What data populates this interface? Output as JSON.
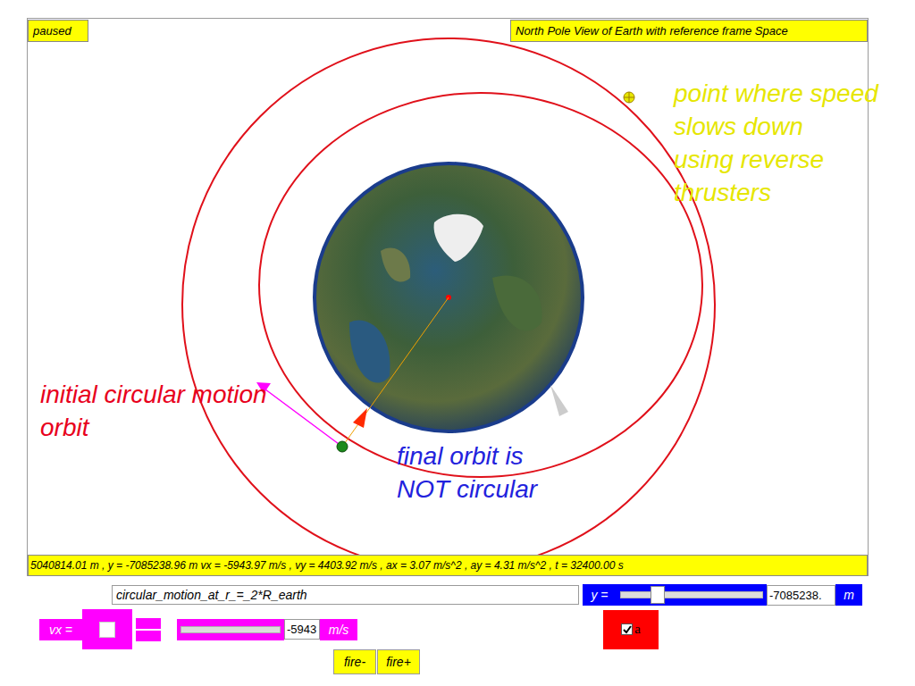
{
  "canvas": {
    "status": "paused",
    "view_title": "North Pole View of Earth with reference frame Space",
    "show_acceleration": true,
    "annotations": [
      {
        "lines": [
          "point where speed",
          "slows down",
          "using reverse",
          "thrusters"
        ],
        "color": "#e6e600"
      },
      {
        "lines": [
          "initial circular motion",
          "orbit"
        ],
        "color": "#e8001c"
      },
      {
        "lines": [
          "final orbit is",
          "NOT circular"
        ],
        "color": "#2222dd"
      }
    ]
  },
  "readout": "5040814.01 m , y = -7085238.96 m vx = -5943.97 m/s , vy = 4403.92 m/s , ax = 3.07 m/s^2 , ay = 4.31 m/s^2 , t = 32400.00 s",
  "scenario": {
    "value": "circular_motion_at_r_=_2*R_earth"
  },
  "y_control": {
    "label": "y =",
    "value": "-7085238.",
    "unit": "m",
    "level": 0.25
  },
  "vx_control": {
    "label": "vx =",
    "value": "-5943",
    "unit": "m/s"
  },
  "acceleration_toggle": {
    "label": "a",
    "checked": true
  },
  "buttons": [
    "fire-",
    "fire+"
  ]
}
